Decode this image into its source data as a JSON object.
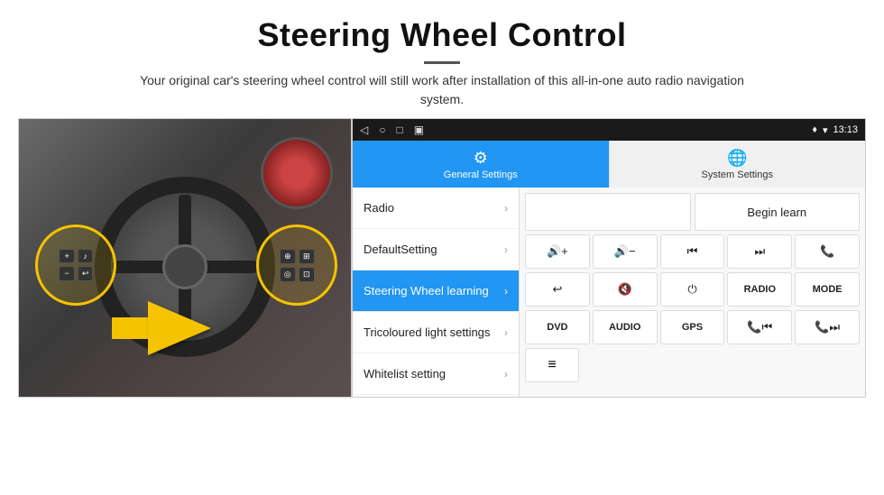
{
  "page": {
    "title": "Steering Wheel Control",
    "subtitle": "Your original car's steering wheel control will still work after installation of this all-in-one auto radio navigation system."
  },
  "status_bar": {
    "back_icon": "◁",
    "home_icon": "○",
    "apps_icon": "□",
    "screenshot_icon": "▣",
    "gps_icon": "♦",
    "signal_icon": "▾",
    "time": "13:13"
  },
  "tabs": [
    {
      "label": "General Settings",
      "icon": "⚙",
      "active": true
    },
    {
      "label": "System Settings",
      "icon": "🌐",
      "active": false
    }
  ],
  "menu_items": [
    {
      "label": "Radio",
      "active": false
    },
    {
      "label": "DefaultSetting",
      "active": false
    },
    {
      "label": "Steering Wheel learning",
      "active": true
    },
    {
      "label": "Tricoloured light settings",
      "active": false
    },
    {
      "label": "Whitelist setting",
      "active": false
    }
  ],
  "controls": {
    "begin_learn": "Begin learn",
    "row2": [
      "🔊+",
      "🔊−",
      "⏮",
      "⏭",
      "📞"
    ],
    "row3_icons": [
      "↩",
      "🔊x",
      "⏻",
      "RADIO",
      "MODE"
    ],
    "row4_labels": [
      "DVD",
      "AUDIO",
      "GPS",
      "📞⏮",
      "📞⏭"
    ],
    "row5_icon": "≡"
  },
  "divider_line": "—"
}
